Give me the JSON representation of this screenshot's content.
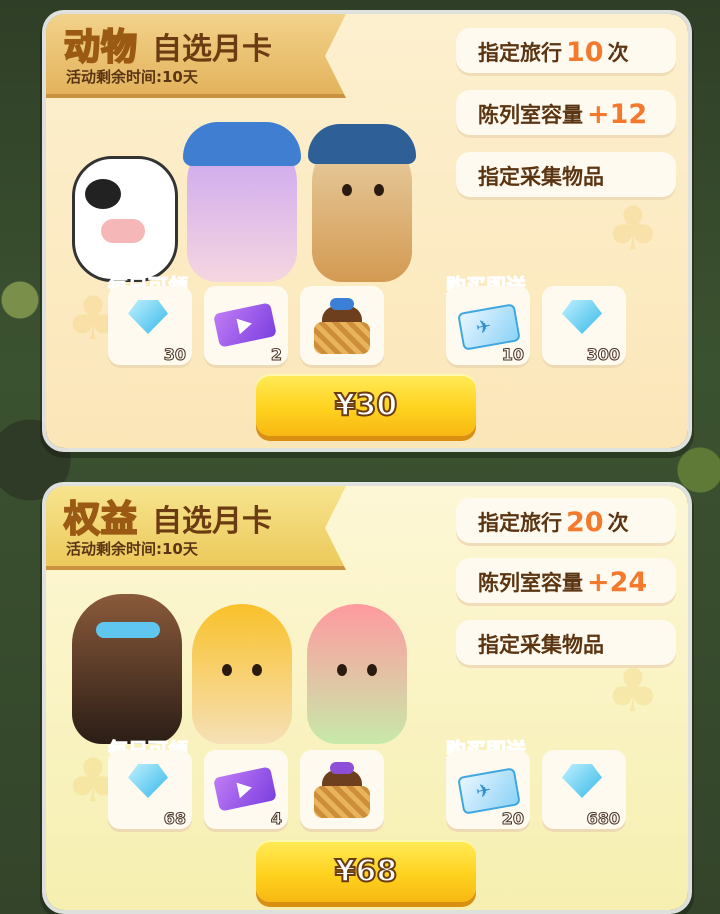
{
  "cards": [
    {
      "title_big": "动物",
      "title_small": "自选月卡",
      "remaining": "活动剩余时间:10天",
      "perks": {
        "travel_prefix": "指定旅行",
        "travel_count": "10",
        "travel_suffix": "次",
        "capacity_label": "陈列室容量",
        "capacity_value": "+12",
        "collect_label": "指定采集物品"
      },
      "daily_label": "每日可领",
      "daily_items": [
        {
          "icon": "gem-icon",
          "count": "30"
        },
        {
          "icon": "video-ticket-icon",
          "count": "2"
        },
        {
          "icon": "basket-icon",
          "count": ""
        }
      ],
      "bonus_label": "购买即送",
      "bonus_items": [
        {
          "icon": "travel-ticket-icon",
          "count": "10"
        },
        {
          "icon": "gem-icon",
          "count": "300"
        }
      ],
      "price": "¥30"
    },
    {
      "title_big": "权益",
      "title_small": "自选月卡",
      "remaining": "活动剩余时间:10天",
      "perks": {
        "travel_prefix": "指定旅行",
        "travel_count": "20",
        "travel_suffix": "次",
        "capacity_label": "陈列室容量",
        "capacity_value": "+24",
        "collect_label": "指定采集物品"
      },
      "daily_label": "每日可领",
      "daily_items": [
        {
          "icon": "gem-icon",
          "count": "68"
        },
        {
          "icon": "video-ticket-icon",
          "count": "4"
        },
        {
          "icon": "basket-icon",
          "count": ""
        }
      ],
      "bonus_label": "购买即送",
      "bonus_items": [
        {
          "icon": "travel-ticket-icon",
          "count": "20"
        },
        {
          "icon": "gem-icon",
          "count": "680"
        }
      ],
      "price": "¥68"
    }
  ],
  "colors": {
    "accent_orange": "#f37a2d",
    "button_yellow": "#ffd21f",
    "text_brown": "#5b3512"
  }
}
